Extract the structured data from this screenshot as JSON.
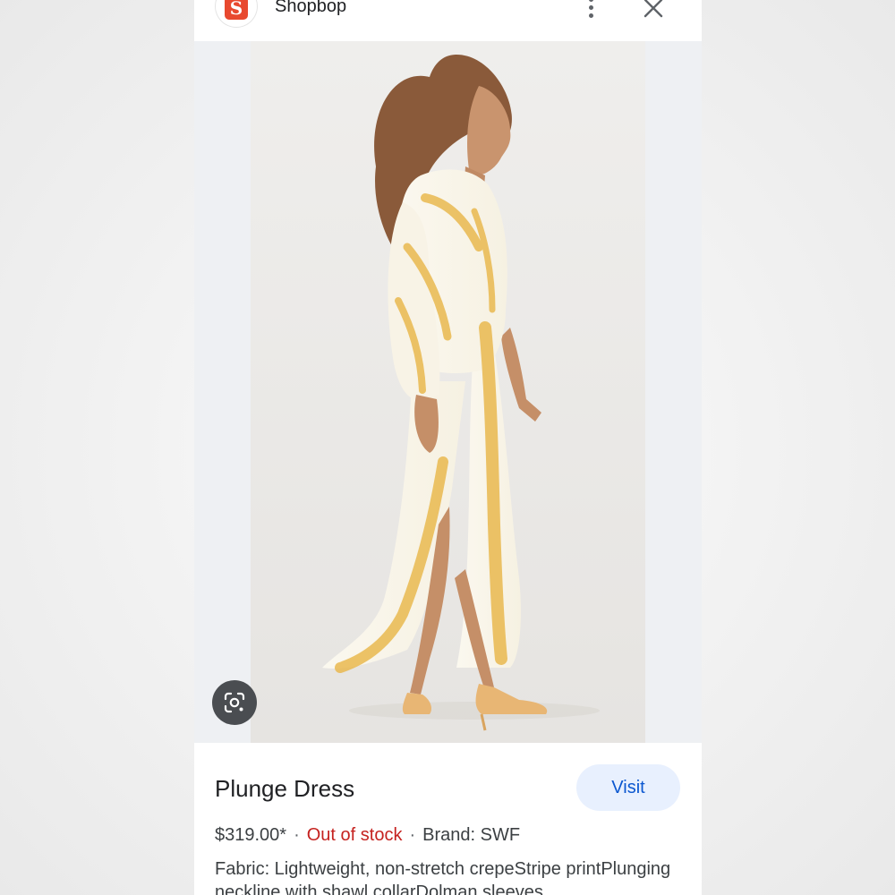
{
  "header": {
    "site_name": "Shopbop",
    "logo_letter": "S",
    "logo_color": "#e8492f"
  },
  "image": {
    "lens_icon": "google-lens-icon"
  },
  "product": {
    "title": "Plunge Dress",
    "visit_label": "Visit",
    "price": "$319.00*",
    "separator": "·",
    "stock_status": "Out of stock",
    "stock_color": "#c5221f",
    "brand": "Brand: SWF",
    "description": "Fabric: Lightweight, non-stretch crepeStripe printPlunging neckline with shawl collarDolman sleeves"
  },
  "colors": {
    "accent": "#0b57d0",
    "visit_bg": "#e8f0fe"
  }
}
